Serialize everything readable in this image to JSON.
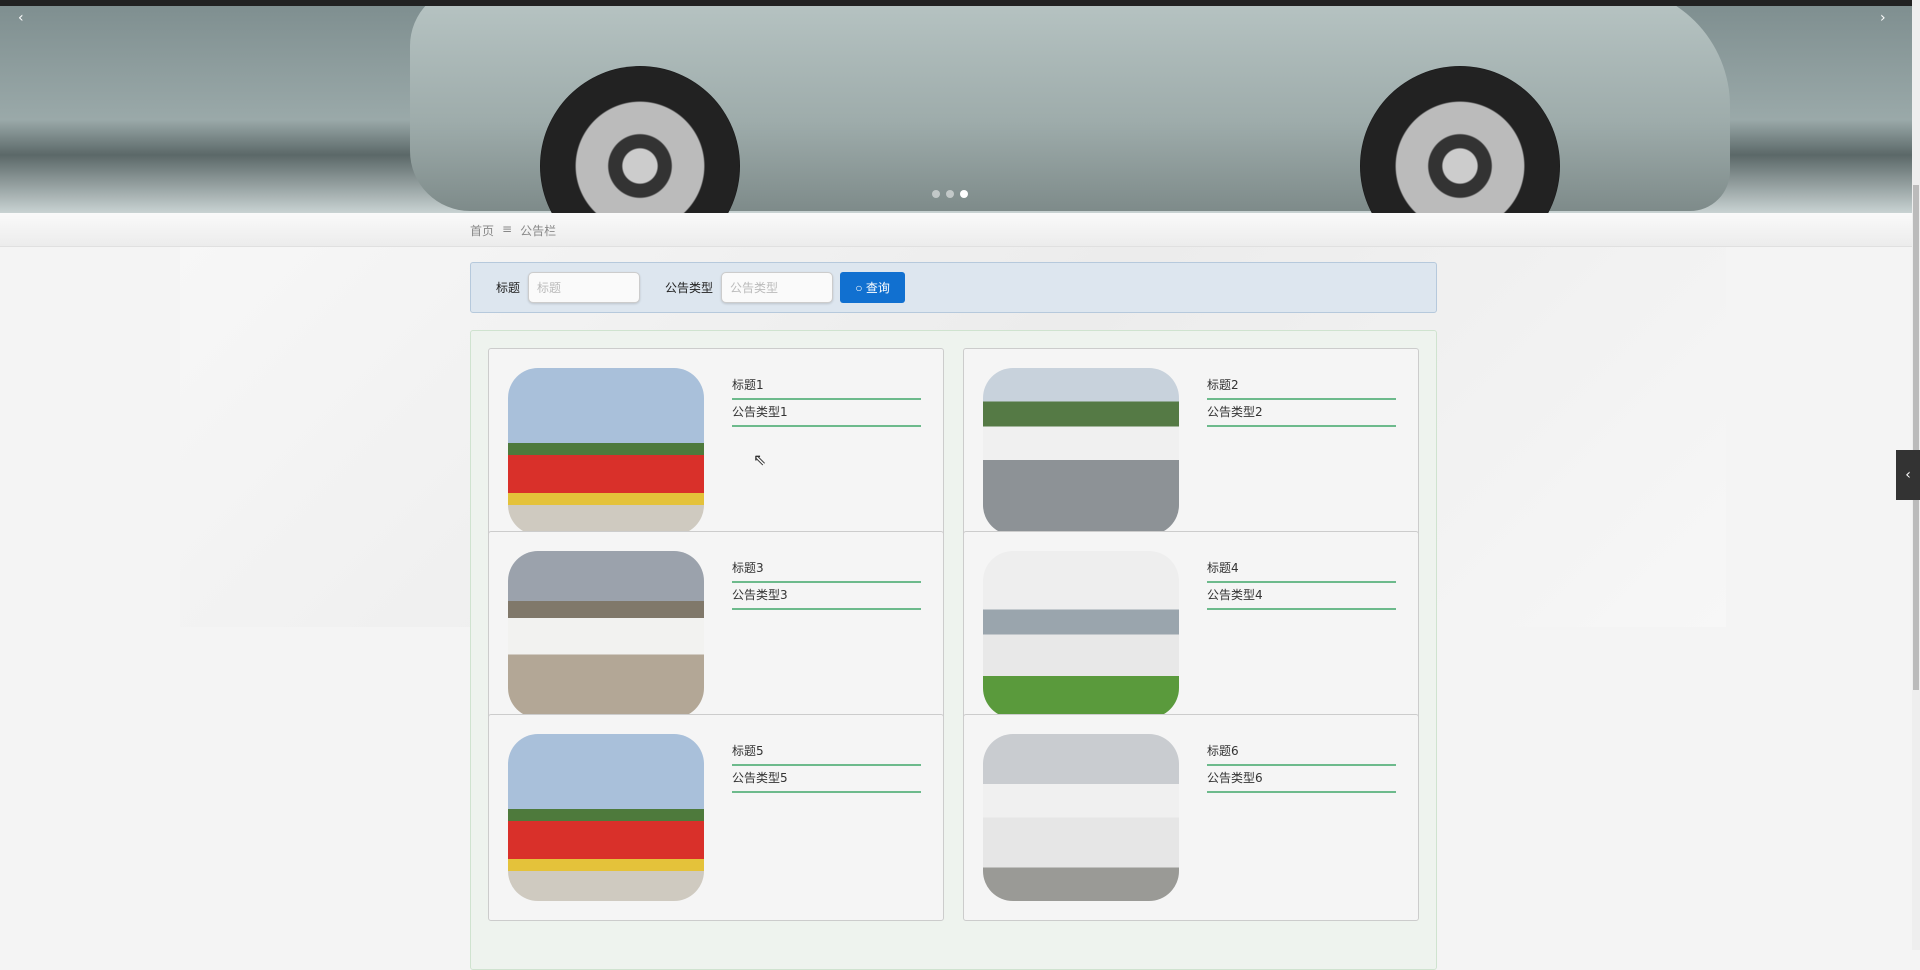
{
  "banner": {
    "dots": 3,
    "active_dot": 3,
    "prev": "‹",
    "next": "›"
  },
  "breadcrumb": {
    "home": "首页",
    "separator": "≡",
    "current": "公告栏"
  },
  "search": {
    "title_label": "标题",
    "title_placeholder": "标题",
    "type_label": "公告类型",
    "type_placeholder": "公告类型",
    "button": "查询"
  },
  "cards": [
    {
      "title": "标题1",
      "type": "公告类型1",
      "img": "linear-gradient(180deg,#a9c0da 0 45%,#4e7a3c 45% 52%,#d9302a 52% 75%,#e4c23a 75% 82%,#cfcac0 82%)"
    },
    {
      "title": "标题2",
      "type": "公告类型2",
      "img": "linear-gradient(180deg,#c8d2dc 0 20%,#557a45 20% 35%,#f0f0f0 35% 55%,#8d9296 55%)"
    },
    {
      "title": "标题3",
      "type": "公告类型3",
      "img": "linear-gradient(180deg,#9ba2ac 0 30%,#80786a 30% 40%,#f2f2f0 40% 62%,#b3a796 62%)"
    },
    {
      "title": "标题4",
      "type": "公告类型4",
      "img": "linear-gradient(180deg,#eeeeee 0 35%,#9aa5ad 35% 50%,#e8e8e8 50% 75%,#5a9a3c 75%)"
    },
    {
      "title": "标题5",
      "type": "公告类型5",
      "img": "linear-gradient(180deg,#a9c0da 0 45%,#4e7a3c 45% 52%,#d9302a 52% 75%,#e4c23a 75% 82%,#cfcac0 82%)"
    },
    {
      "title": "标题6",
      "type": "公告类型6",
      "img": "linear-gradient(180deg,#c9ccd0 0 30%,#f0f0f0 30% 50%,#e6e6e6 50% 80%,#9a9a96 80%)"
    }
  ],
  "sidetab": "‹"
}
